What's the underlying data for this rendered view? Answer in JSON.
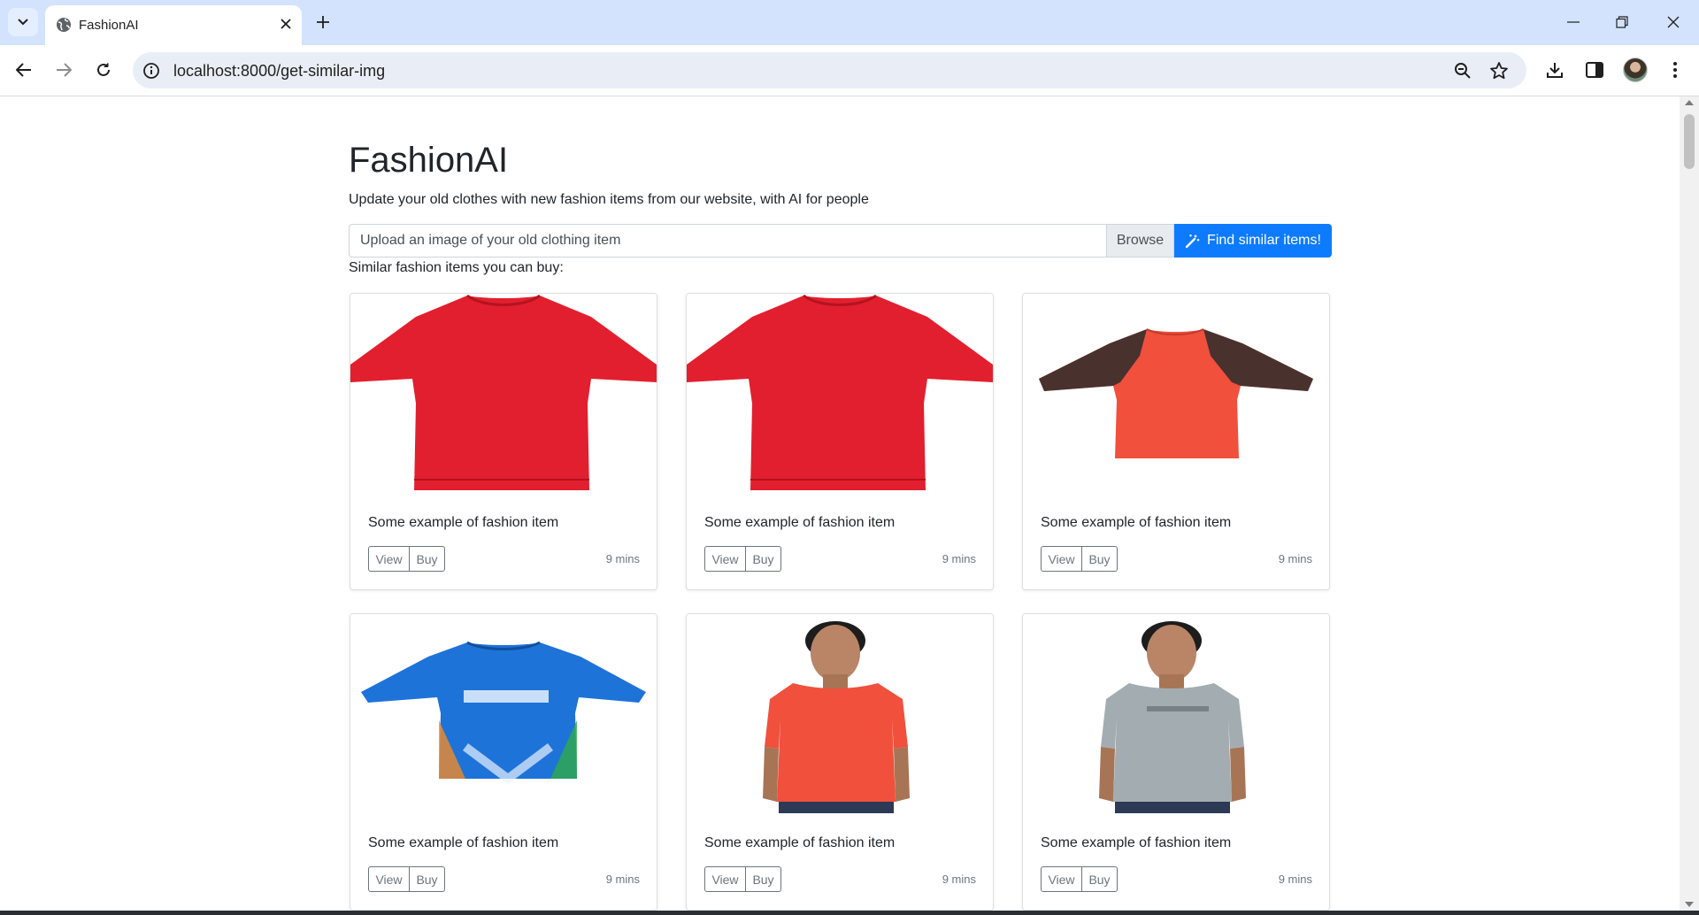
{
  "browser": {
    "tab_title": "FashionAI",
    "url": "localhost:8000/get-similar-img"
  },
  "page": {
    "title": "FashionAI",
    "lead": "Update your old clothes with new fashion items from our website, with AI for people",
    "upload_placeholder": "Upload an image of your old clothing item",
    "browse_label": "Browse",
    "find_button": "Find similar items!",
    "section_label": "Similar fashion items you can buy:"
  },
  "colors": {
    "primary": "#0d7bff",
    "red_shirt": "#e21f2f",
    "orange_shirt": "#f0503c",
    "blue_jersey": "#1e73d8",
    "grey_shirt": "#a3adb1"
  },
  "cards": [
    {
      "text": "Some example of fashion item",
      "view": "View",
      "buy": "Buy",
      "time": "9 mins",
      "image": "red-tshirt"
    },
    {
      "text": "Some example of fashion item",
      "view": "View",
      "buy": "Buy",
      "time": "9 mins",
      "image": "red-tshirt"
    },
    {
      "text": "Some example of fashion item",
      "view": "View",
      "buy": "Buy",
      "time": "9 mins",
      "image": "orange-sports-tshirt"
    },
    {
      "text": "Some example of fashion item",
      "view": "View",
      "buy": "Buy",
      "time": "9 mins",
      "image": "blue-cricket-jersey"
    },
    {
      "text": "Some example of fashion item",
      "view": "View",
      "buy": "Buy",
      "time": "9 mins",
      "image": "model-orange-tshirt"
    },
    {
      "text": "Some example of fashion item",
      "view": "View",
      "buy": "Buy",
      "time": "9 mins",
      "image": "model-grey-tshirt"
    }
  ]
}
